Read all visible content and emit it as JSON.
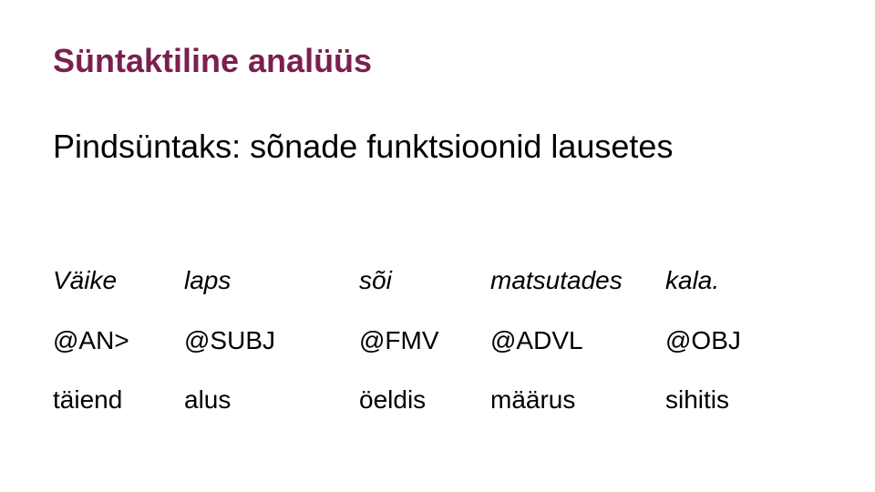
{
  "slide": {
    "title": "Süntaktiline analüüs",
    "subtitle": "Pindsüntaks: sõnade funktsioonid lausetes",
    "colors": {
      "title": "#7b1f4f",
      "text": "#000000",
      "background": "#ffffff"
    },
    "words": [
      "Väike",
      "laps",
      "sõi",
      "matsutades",
      "kala."
    ],
    "tags": [
      "@AN>",
      "@SUBJ",
      "@FMV",
      "@ADVL",
      "@OBJ"
    ],
    "roles": [
      "täiend",
      "alus",
      "öeldis",
      "määrus",
      "sihitis"
    ]
  }
}
